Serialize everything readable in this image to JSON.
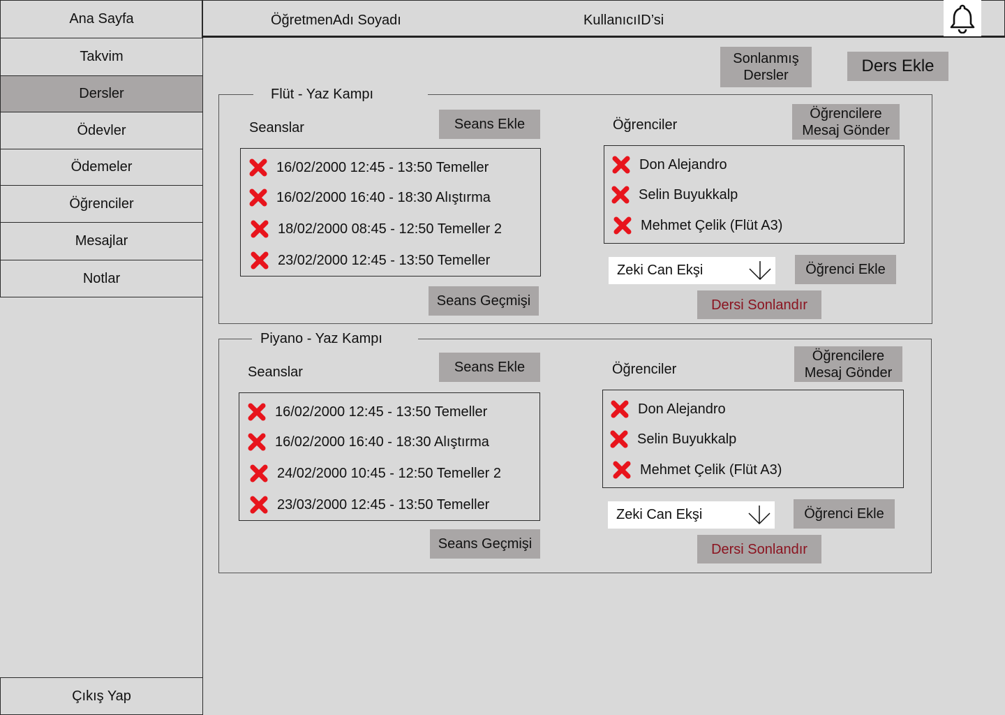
{
  "sidebar": {
    "items": [
      {
        "label": "Ana Sayfa"
      },
      {
        "label": "Takvim"
      },
      {
        "label": "Dersler"
      },
      {
        "label": "Ödevler"
      },
      {
        "label": "Ödemeler"
      },
      {
        "label": "Öğrenciler"
      },
      {
        "label": "Mesajlar"
      },
      {
        "label": "Notlar"
      }
    ],
    "active": "Dersler",
    "logout_label": "Çıkış Yap"
  },
  "header": {
    "teacher_name": "ÖğretmenAdı Soyadı",
    "user_id": "KullanıcıID’si",
    "notification_icon": "bell-icon"
  },
  "toolbar": {
    "finished_courses_label": "Sonlanmış\nDersler",
    "add_course_label": "Ders Ekle"
  },
  "courses": [
    {
      "title": "Flüt - Yaz Kampı",
      "sessions_label": "Seanslar",
      "add_session_label": "Seans Ekle",
      "sessions": [
        "16/02/2000 12:45 - 13:50 Temeller",
        "16/02/2000 16:40 - 18:30 Alıştırma",
        "18/02/2000 08:45 - 12:50 Temeller 2",
        "23/02/2000 12:45 - 13:50 Temeller"
      ],
      "session_history_label": "Seans Geçmişi",
      "students_label": "Öğrenciler",
      "message_students_label": "Öğrencilere\nMesaj Gönder",
      "students": [
        "Don Alejandro",
        "Selin Buyukkalp",
        "Mehmet Çelik (Flüt A3)"
      ],
      "student_select_value": "Zeki Can Ekşi",
      "add_student_label": "Öğrenci Ekle",
      "end_course_label": "Dersi Sonlandır"
    },
    {
      "title": "Piyano - Yaz Kampı",
      "sessions_label": "Seanslar",
      "add_session_label": "Seans Ekle",
      "sessions": [
        "16/02/2000 12:45 - 13:50 Temeller",
        "16/02/2000 16:40 - 18:30 Alıştırma",
        "24/02/2000 10:45 - 12:50 Temeller 2",
        "23/03/2000 12:45 - 13:50 Temeller"
      ],
      "session_history_label": "Seans Geçmişi",
      "students_label": "Öğrenciler",
      "message_students_label": "Öğrencilere\nMesaj Gönder",
      "students": [
        "Don Alejandro",
        "Selin Buyukkalp",
        "Mehmet Çelik (Flüt A3)"
      ],
      "student_select_value": "Zeki Can Ekşi",
      "add_student_label": "Öğrenci Ekle",
      "end_course_label": "Dersi Sonlandır"
    }
  ],
  "colors": {
    "background": "#d9d9d9",
    "button": "#a9a6a6",
    "active_nav": "#a9a6a6",
    "danger_text": "#8b1420",
    "delete_icon": "#e8141c"
  }
}
